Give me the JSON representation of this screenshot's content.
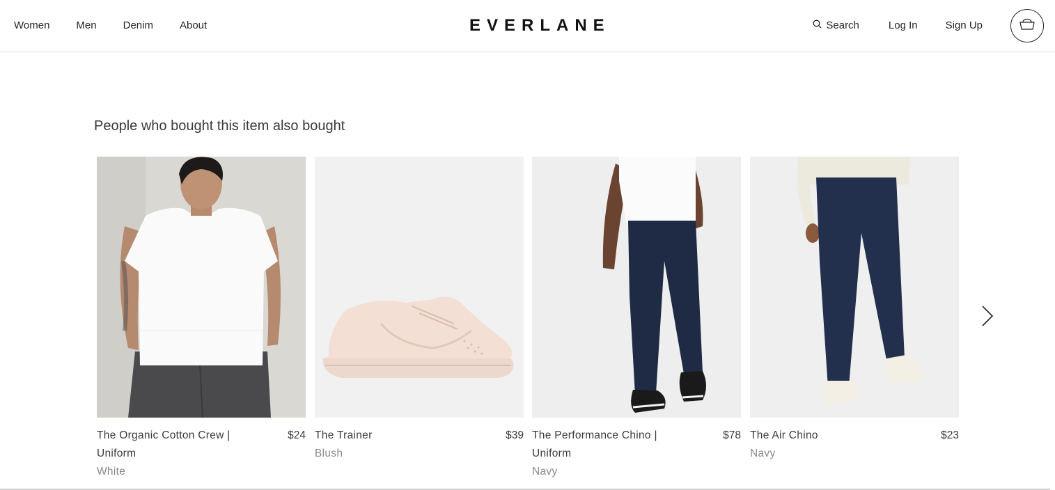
{
  "header": {
    "nav": [
      "Women",
      "Men",
      "Denim",
      "About"
    ],
    "logo": "EVERLANE",
    "search_label": "Search",
    "login_label": "Log In",
    "signup_label": "Sign Up"
  },
  "recommendations": {
    "title": "People who bought this item also bought",
    "products": [
      {
        "name": "The Organic Cotton Crew | Uniform",
        "price": "$24",
        "color": "White"
      },
      {
        "name": "The Trainer",
        "price": "$39",
        "color": "Blush"
      },
      {
        "name": "The Performance Chino | Uniform",
        "price": "$78",
        "color": "Navy"
      },
      {
        "name": "The Air Chino",
        "price": "$23",
        "color": "Navy"
      }
    ]
  },
  "icons": {
    "search": "search-icon",
    "cart": "cart-icon",
    "next": "chevron-right-icon"
  }
}
